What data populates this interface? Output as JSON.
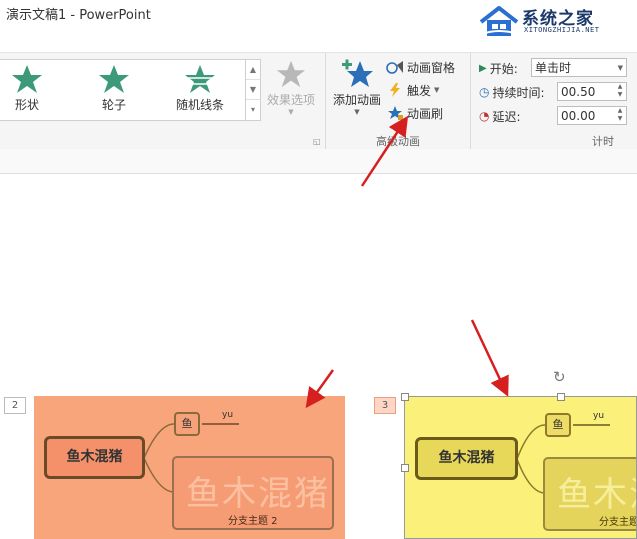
{
  "window": {
    "title": "演示文稿1 - PowerPoint"
  },
  "watermark": {
    "name": "系统之家",
    "url": "XITONGZHIJIA.NET"
  },
  "ribbon": {
    "gallery": [
      {
        "label": "形状",
        "icon": "star-shape-icon"
      },
      {
        "label": "轮子",
        "icon": "star-wheel-icon"
      },
      {
        "label": "随机线条",
        "icon": "star-random-lines-icon"
      }
    ],
    "effect_options": "效果选项",
    "advanced": {
      "add_animation": "添加动画",
      "animation_pane": "动画窗格",
      "trigger": "触发",
      "animation_painter": "动画刷",
      "group_label": "高级动画"
    },
    "timing": {
      "start_label": "开始:",
      "start_value": "单击时",
      "duration_label": "持续时间:",
      "duration_value": "00.50",
      "delay_label": "延迟:",
      "delay_value": "00.00",
      "group_label": "计时"
    }
  },
  "slides": [
    {
      "number": "2",
      "central": "鱼木混猪",
      "subtopic": "鱼",
      "subtopic_note": "yu",
      "big_text": "鱼木混猪",
      "branch": "分支主题 2",
      "color": "#f8a57c"
    },
    {
      "number": "3",
      "central": "鱼木混猪",
      "subtopic": "鱼",
      "subtopic_note": "yu",
      "big_text": "鱼木混猪",
      "branch": "分支主题",
      "color": "#faf07a"
    }
  ],
  "colors": {
    "arrow": "#d62020",
    "accent_star": "#3d9a78"
  }
}
